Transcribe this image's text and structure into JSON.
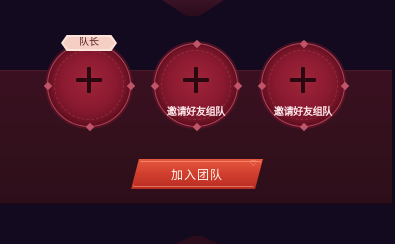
{
  "team": {
    "leader_badge": "队长",
    "slots": [
      {
        "role": "leader",
        "invite_label": ""
      },
      {
        "role": "empty",
        "invite_label": "邀请好友组队"
      },
      {
        "role": "empty",
        "invite_label": "邀请好友组队"
      }
    ]
  },
  "actions": {
    "join_label": "加入团队"
  },
  "colors": {
    "background": "#140a1f",
    "panel": "#3a1020",
    "slot_fill": "#8a1a30",
    "button": "#d03e2e",
    "badge": "#f6cfc4"
  },
  "icons": {
    "add": "plus-icon",
    "button_corner": "heart-icon"
  }
}
